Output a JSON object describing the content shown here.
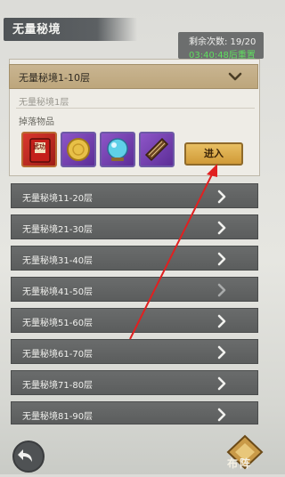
{
  "header": {
    "title": "无量秘境",
    "remaining": "剩余次数: 19/20",
    "reset_timer": "03:40:48后重置"
  },
  "expanded": {
    "label": "无量秘境1-10层",
    "sub_label": "无量秘境1层",
    "drops_label": "掉落物品",
    "drops": [
      {
        "icon": "scroll-book-icon",
        "text": "武功"
      },
      {
        "icon": "gold-coin-icon"
      },
      {
        "icon": "crystal-orb-icon"
      },
      {
        "icon": "zither-icon"
      }
    ],
    "enter_label": "进入"
  },
  "floors": [
    {
      "label": "无量秘境11-20层"
    },
    {
      "label": "无量秘境21-30层"
    },
    {
      "label": "无量秘境31-40层"
    },
    {
      "label": "无量秘境41-50层"
    },
    {
      "label": "无量秘境51-60层"
    },
    {
      "label": "无量秘境61-70层"
    },
    {
      "label": "无量秘境71-80层"
    },
    {
      "label": "无量秘境81-90层"
    }
  ],
  "footer": {
    "back_icon": "back-arrow-icon",
    "formation_label": "布阵"
  },
  "colors": {
    "accent_gold": "#d09a38",
    "timer_green": "#5fdf5f",
    "annotation_red": "#e02020"
  }
}
